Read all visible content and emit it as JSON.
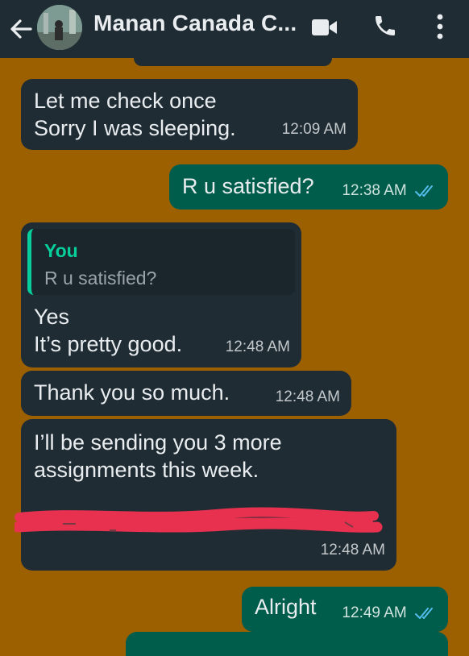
{
  "header": {
    "contact_name": "Manan Canada C...",
    "icons": [
      "back-arrow-icon",
      "video-call-icon",
      "phone-icon",
      "more-vertical-icon"
    ]
  },
  "messages": [
    {
      "direction": "in",
      "lines": [
        "Let me check once",
        "Sorry I was sleeping."
      ],
      "time": "12:09 AM"
    },
    {
      "direction": "out",
      "lines": [
        "R u satisfied?"
      ],
      "time": "12:38 AM",
      "status": "read"
    },
    {
      "direction": "in",
      "quote": {
        "author": "You",
        "text": "R u satisfied?"
      },
      "lines": [
        "Yes",
        "It’s pretty good."
      ],
      "time": "12:48 AM"
    },
    {
      "direction": "in",
      "lines": [
        "Thank you so much."
      ],
      "time": "12:48 AM"
    },
    {
      "direction": "in",
      "lines": [
        "I’ll be sending you 3 more",
        "assignments this week."
      ],
      "time": "12:48 AM",
      "redacted": true
    },
    {
      "direction": "out",
      "lines": [
        "Alright"
      ],
      "time": "12:49 AM",
      "status": "read"
    }
  ],
  "colors": {
    "chat_background": "#9c6000",
    "header": "#1f2c34",
    "incoming_bubble": "#1f2c34",
    "outgoing_bubble": "#005c4b",
    "read_ticks": "#53bdeb",
    "quote_accent": "#06cf9c",
    "redaction": "#e8314f"
  }
}
